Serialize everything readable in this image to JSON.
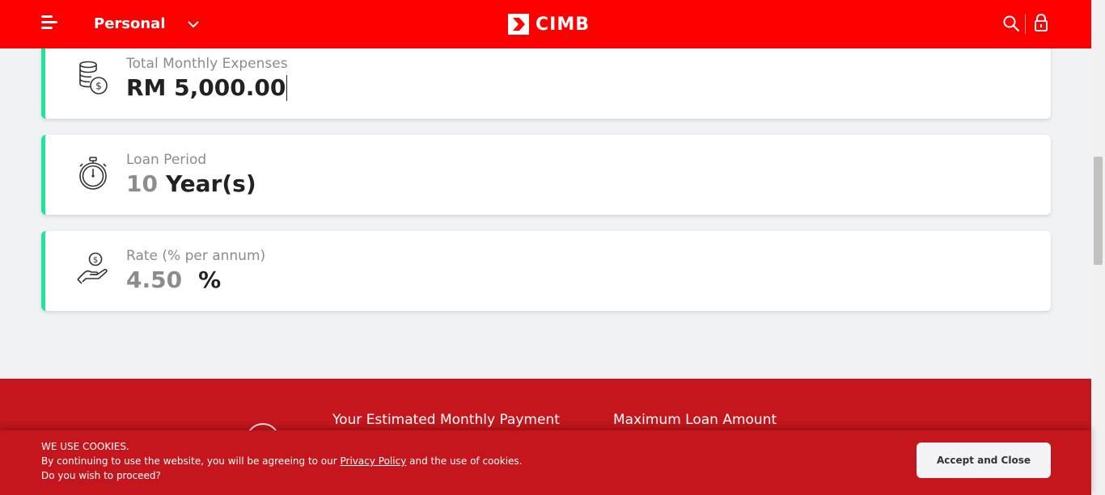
{
  "header": {
    "segment_label": "Personal",
    "logo_text": "CIMB",
    "menu_icon": "hamburger-menu-icon",
    "search_icon": "search-icon",
    "lock_icon": "lock-icon",
    "brand_color": "#fe0000"
  },
  "cards": {
    "expenses": {
      "icon": "coins-stack-icon",
      "label": "Total Monthly Expenses",
      "value": "RM 5,000.00"
    },
    "loan_period": {
      "icon": "stopwatch-icon",
      "label": "Loan Period",
      "value": "10",
      "unit": "Year(s)"
    },
    "rate": {
      "icon": "hand-coin-icon",
      "label": "Rate (% per annum)",
      "value": "4.50",
      "unit": "%"
    },
    "accent_color": "#1de59a"
  },
  "results": {
    "monthly_payment_label": "Your Estimated Monthly Payment",
    "max_loan_label": "Maximum Loan Amount",
    "background_color": "#c4161c"
  },
  "cookie_banner": {
    "title": "WE USE COOKIES.",
    "line1_prefix": "By continuing to use the website, you will be agreeing to our",
    "privacy_link": "Privacy Policy",
    "line1_suffix": "and the use of cookies.",
    "line2": "Do you wish to proceed?",
    "accept_label": "Accept and Close"
  }
}
